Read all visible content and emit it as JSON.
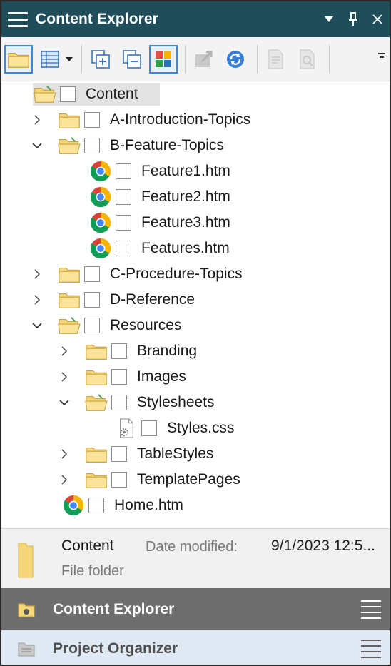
{
  "titlebar": {
    "title": "Content Explorer",
    "dropdown_glyph": "▾",
    "pin_glyph": "📌",
    "close_glyph": "✕"
  },
  "toolbar": {
    "dropdown_glyph": "▾"
  },
  "tree": {
    "root": {
      "label": "Content"
    },
    "items": [
      {
        "label": "A-Introduction-Topics"
      },
      {
        "label": "B-Feature-Topics"
      },
      {
        "label": "Feature1.htm"
      },
      {
        "label": "Feature2.htm"
      },
      {
        "label": "Feature3.htm"
      },
      {
        "label": "Features.htm"
      },
      {
        "label": "C-Procedure-Topics"
      },
      {
        "label": "D-Reference"
      },
      {
        "label": "Resources"
      },
      {
        "label": "Branding"
      },
      {
        "label": "Images"
      },
      {
        "label": "Stylesheets"
      },
      {
        "label": "Styles.css"
      },
      {
        "label": "TableStyles"
      },
      {
        "label": "TemplatePages"
      },
      {
        "label": "Home.htm"
      }
    ]
  },
  "info": {
    "name": "Content",
    "date_modified_label": "Date modified:",
    "date_modified_value": "9/1/2023 12:5...",
    "type": "File folder"
  },
  "panes": {
    "content_explorer": {
      "label": "Content Explorer"
    },
    "project_organizer": {
      "label": "Project Organizer"
    }
  },
  "colors": {
    "titlebar_bg": "#1f4e5a",
    "folder_yellow": "#f5d77a",
    "selection_bg": "#e3e3e3",
    "active_pane_bg": "#6e6e6e",
    "inactive_pane_bg": "#dfe9f3",
    "toolbar_active_border": "#3a88d6"
  }
}
